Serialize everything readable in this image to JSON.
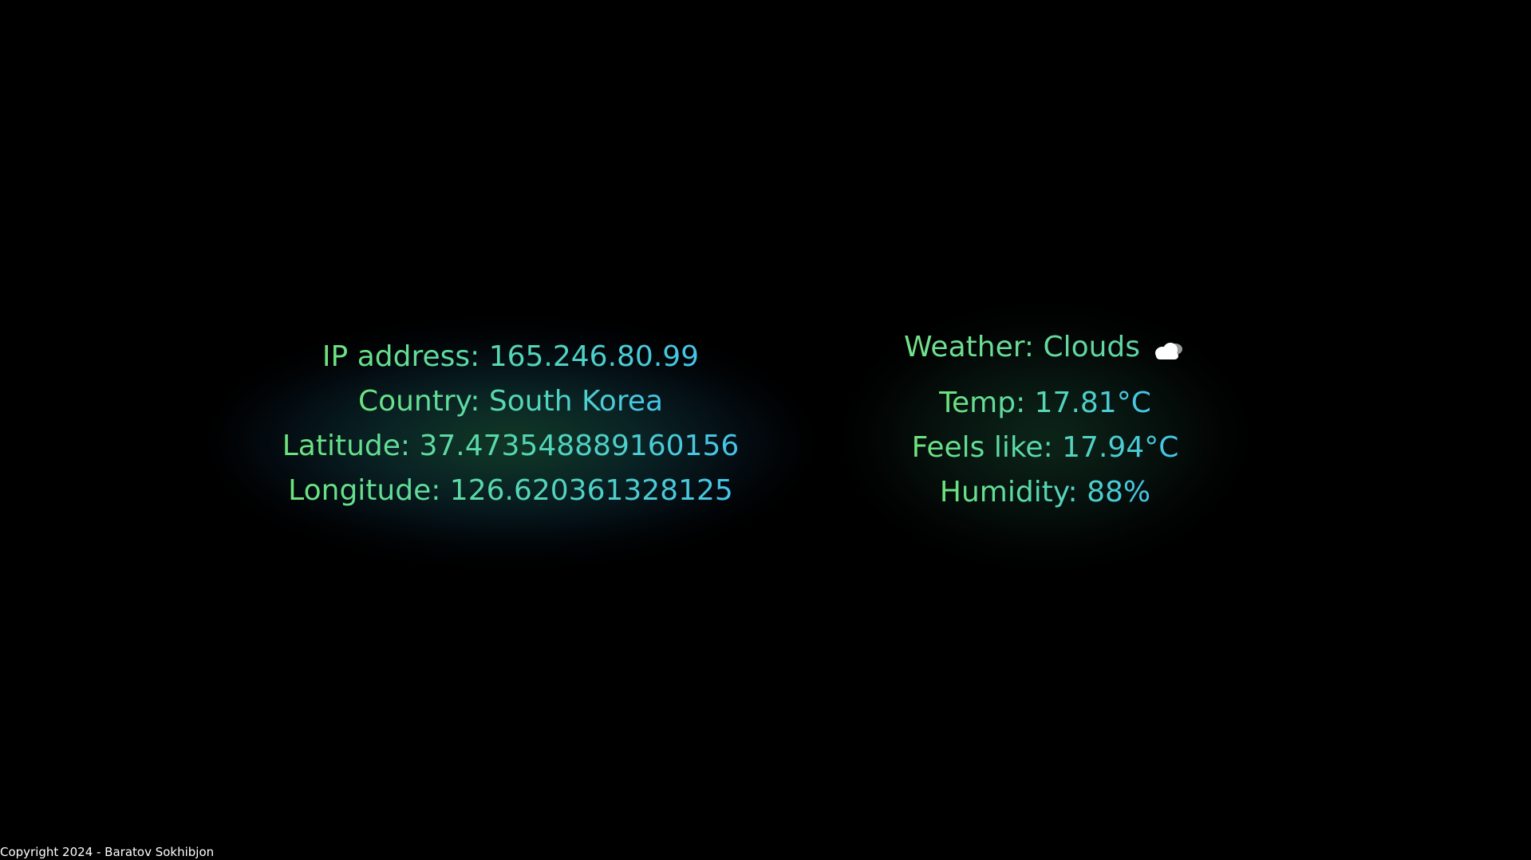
{
  "ip_panel": {
    "lines": [
      "IP address: 165.246.80.99",
      "Country: South Korea",
      "Latitude: 37.473548889160156",
      "Longitude: 126.620361328125"
    ]
  },
  "weather_panel": {
    "title": "Weather: Clouds",
    "icon": "cloud-icon",
    "lines": [
      "Temp: 17.81°C",
      "Feels like: 17.94°C",
      "Humidity: 88%"
    ]
  },
  "footer": {
    "copyright": "Copyright 2024 - Baratov Sokhibjon"
  },
  "colors": {
    "background": "#000000",
    "text_green": "#6ee37c",
    "text_teal": "#54d6b8",
    "text_blue": "#45c4ea"
  }
}
